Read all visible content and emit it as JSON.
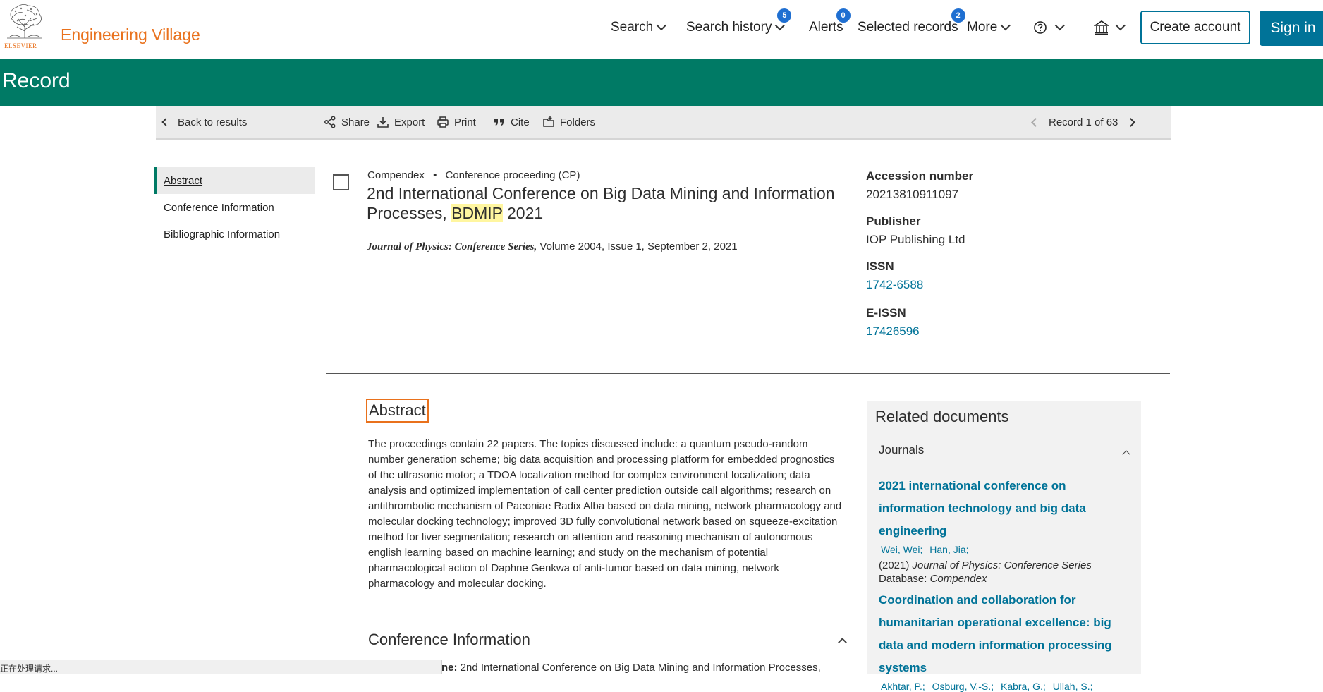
{
  "header": {
    "logo_text": "ELSEVIER",
    "brand": "Engineering Village",
    "nav": {
      "search": "Search",
      "search_history": "Search history",
      "search_history_count": "5",
      "alerts": "Alerts",
      "alerts_count": "0",
      "selected_records": "Selected records",
      "selected_records_count": "2",
      "more": "More"
    },
    "create_account": "Create account",
    "sign_in": "Sign in"
  },
  "page_title": "Record",
  "toolbar": {
    "back": "Back to results",
    "share": "Share",
    "export": "Export",
    "print": "Print",
    "cite": "Cite",
    "folders": "Folders",
    "record_position": "Record 1 of 63"
  },
  "leftnav": {
    "items": [
      "Abstract",
      "Conference Information",
      "Bibliographic Information"
    ]
  },
  "record": {
    "database": "Compendex",
    "doc_type": "Conference proceeding (CP)",
    "title_before": "2nd International Conference on Big Data Mining and Information Processes, ",
    "title_highlight": "BDMIP",
    "title_after": " 2021",
    "journal_name": "Journal of Physics: Conference Series,",
    "journal_details": " Volume 2004, Issue 1, September 2, 2021"
  },
  "info": {
    "accession_label": "Accession number",
    "accession_value": "20213810911097",
    "publisher_label": "Publisher",
    "publisher_value": "IOP Publishing Ltd",
    "issn_label": "ISSN",
    "issn_value": "1742-6588",
    "eissn_label": "E-ISSN",
    "eissn_value": "17426596"
  },
  "abstract": {
    "heading": "Abstract",
    "text": "The proceedings contain 22 papers. The topics discussed include: a quantum pseudo-random number generation scheme; big data acquisition and processing platform for embedded prognostics of the ultrasonic motor; a TDOA localization method for complex environment localization; data analysis and optimized implementation of call center prediction outside call algorithms; research on antithrombotic mechanism of Paeoniae Radix Alba based on data mining, network pharmacology and molecular docking technology; improved 3D fully convolutional network based on squeeze-excitation method for liver segmentation; research on attention and reasoning mechanism of autonomous english learning based on machine learning; and study on the mechanism of potential pharmacological action of Daphne Genkwa of anti-tumor based on data mining, network pharmacology and molecular docking."
  },
  "conference": {
    "heading": "Conference Information",
    "partial_label": "ne:",
    "partial_value": " 2nd International Conference on Big Data Mining and Information Processes,"
  },
  "related": {
    "title": "Related documents",
    "section": "Journals",
    "docs": [
      {
        "title": "2021 international conference on information technology and big data engineering",
        "authors": [
          "Wei, Wei;",
          "Han, Jia;"
        ],
        "year": "(2021)",
        "source": "Journal of Physics: Conference Series",
        "database_label": "Database:",
        "database": "Compendex"
      },
      {
        "title": "Coordination and collaboration for humanitarian operational excellence: big data and modern information processing systems",
        "authors": [
          "Akhtar, P.;",
          "Osburg, V.-S.;",
          "Kabra, G.;",
          "Ullah, S.;"
        ]
      }
    ]
  },
  "status_bar": "正在处理请求..."
}
